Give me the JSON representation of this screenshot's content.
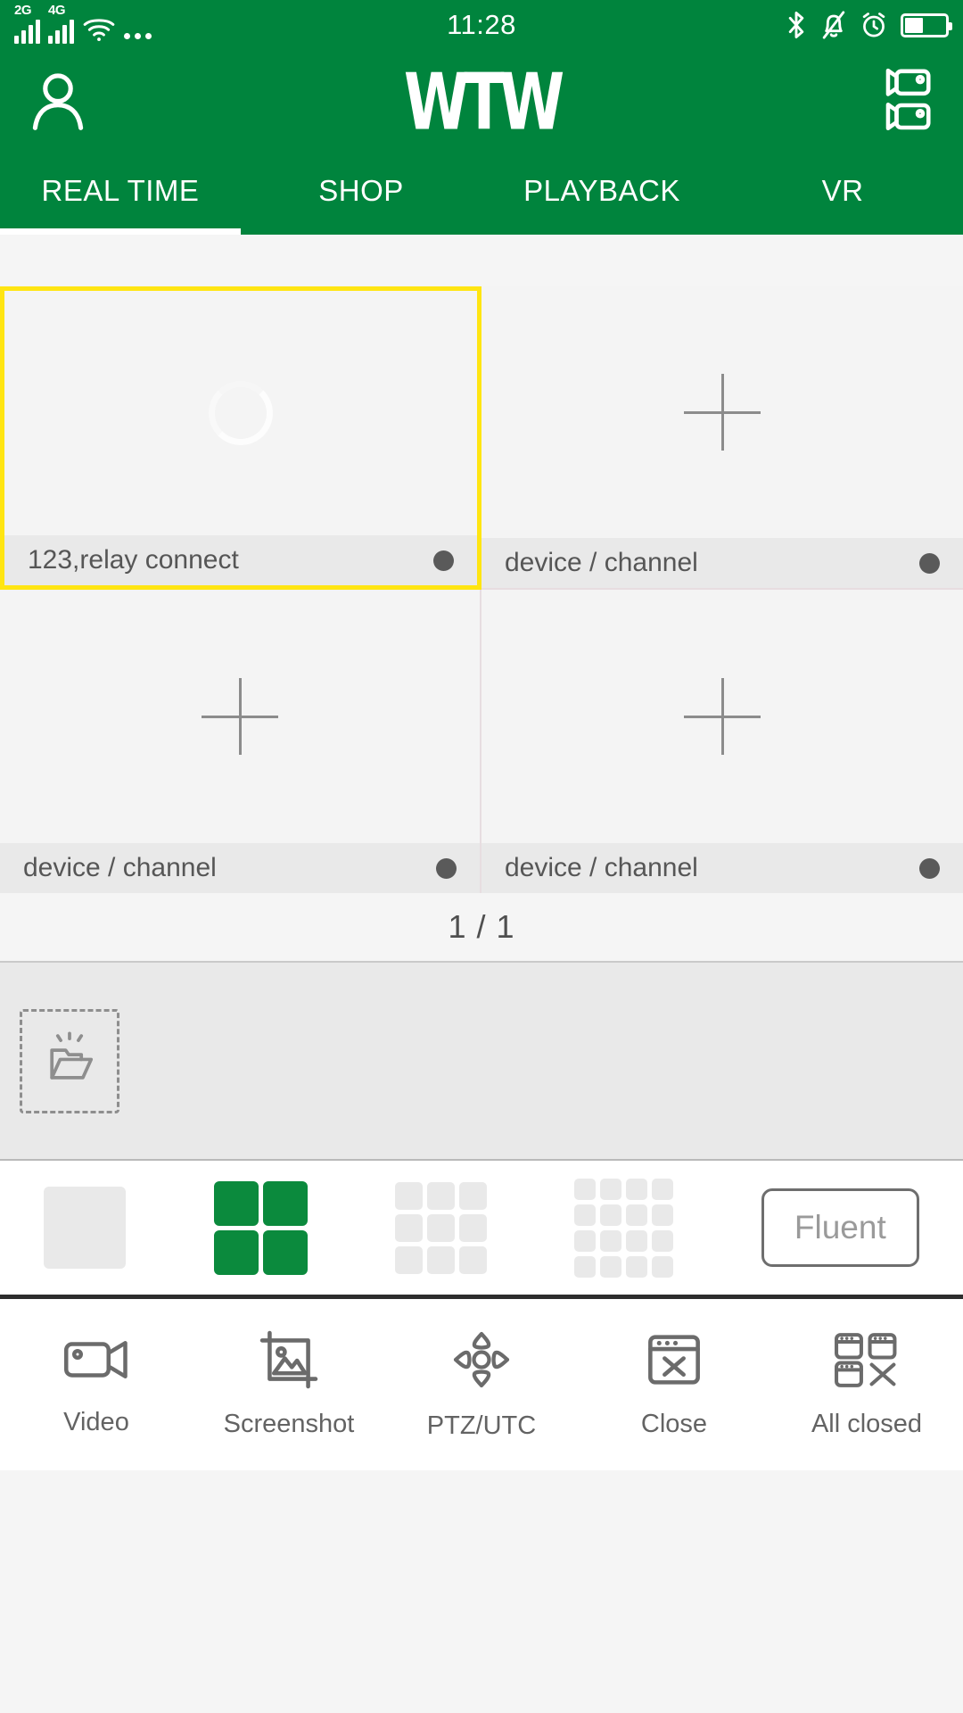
{
  "status_bar": {
    "network_1": "2G",
    "network_2": "4G",
    "time": "11:28",
    "icons": [
      "wifi-icon",
      "more-dots-icon",
      "bluetooth-icon",
      "bell-muted-icon",
      "alarm-clock-icon",
      "battery-icon"
    ],
    "battery_level_percent": 45
  },
  "header": {
    "title": "WTW",
    "profile_icon": "person-icon",
    "camera_list_icon": "camera-list-icon"
  },
  "tabs": [
    {
      "label": "REAL TIME",
      "active": true
    },
    {
      "label": "SHOP",
      "active": false
    },
    {
      "label": "PLAYBACK",
      "active": false
    },
    {
      "label": "VR",
      "active": false
    }
  ],
  "video_grid": {
    "cells": [
      {
        "label": "123,relay connect",
        "state": "connecting",
        "selected": true,
        "status_dot": "#5a5a5a"
      },
      {
        "label": "device / channel",
        "state": "empty",
        "selected": false,
        "status_dot": "#5a5a5a"
      },
      {
        "label": "device / channel",
        "state": "empty",
        "selected": false,
        "status_dot": "#5a5a5a"
      },
      {
        "label": "device / channel",
        "state": "empty",
        "selected": false,
        "status_dot": "#5a5a5a"
      }
    ],
    "selection_color": "#FFE512",
    "page_indicator": "1 / 1"
  },
  "dropzone": {
    "icon": "open-folder-icon"
  },
  "layout_selector": {
    "options": [
      {
        "name": "layout-1x1",
        "grid": 1,
        "selected": false
      },
      {
        "name": "layout-2x2",
        "grid": 2,
        "selected": true
      },
      {
        "name": "layout-3x3",
        "grid": 3,
        "selected": false
      },
      {
        "name": "layout-4x4",
        "grid": 4,
        "selected": false
      }
    ],
    "quality_label": "Fluent",
    "active_color": "#0B8A3D"
  },
  "bottom_toolbar": [
    {
      "label": "Video",
      "icon": "camcorder-icon"
    },
    {
      "label": "Screenshot",
      "icon": "image-crop-icon"
    },
    {
      "label": "PTZ/UTC",
      "icon": "dpad-icon"
    },
    {
      "label": "Close",
      "icon": "window-close-icon"
    },
    {
      "label": "All closed",
      "icon": "all-windows-close-icon"
    }
  ],
  "theme": {
    "brand_green": "#00843D",
    "accent_yellow": "#FFE512",
    "panel_gray": "#e9e9e9"
  }
}
